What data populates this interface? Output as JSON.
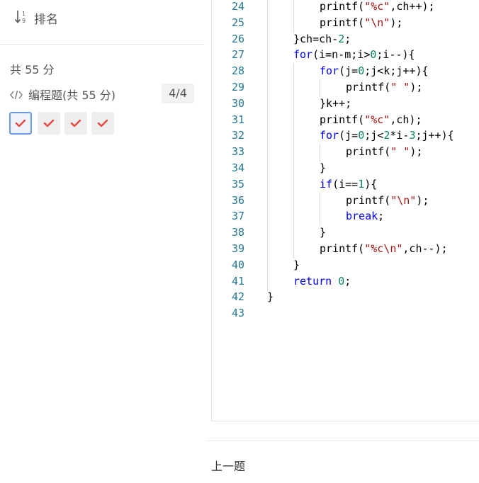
{
  "sidebar": {
    "rank_label": "排名",
    "total_score": "共 55 分",
    "section": {
      "label": "编程题(共 55 分)",
      "count": "4/4"
    },
    "answers": [
      {
        "status": "correct",
        "active": true
      },
      {
        "status": "correct",
        "active": false
      },
      {
        "status": "correct",
        "active": false
      },
      {
        "status": "correct",
        "active": false
      }
    ]
  },
  "code": {
    "lines": [
      {
        "num": "24",
        "indent": 2,
        "tokens": [
          [
            "",
            "printf("
          ],
          [
            "str",
            "\"%c\""
          ],
          [
            "",
            ",ch++);"
          ]
        ]
      },
      {
        "num": "25",
        "indent": 2,
        "tokens": [
          [
            "",
            "printf("
          ],
          [
            "str",
            "\"\\n\""
          ],
          [
            "",
            ");"
          ]
        ]
      },
      {
        "num": "26",
        "indent": 1,
        "tokens": [
          [
            "",
            "}ch=ch-"
          ],
          [
            "num",
            "2"
          ],
          [
            "",
            ";"
          ]
        ]
      },
      {
        "num": "27",
        "indent": 1,
        "tokens": [
          [
            "kw",
            "for"
          ],
          [
            "",
            "(i=n-m;i>"
          ],
          [
            "num",
            "0"
          ],
          [
            "",
            ";i--){"
          ]
        ]
      },
      {
        "num": "28",
        "indent": 2,
        "tokens": [
          [
            "kw",
            "for"
          ],
          [
            "",
            "(j="
          ],
          [
            "num",
            "0"
          ],
          [
            "",
            ";j<k;j++){"
          ]
        ]
      },
      {
        "num": "29",
        "indent": 3,
        "tokens": [
          [
            "",
            "printf("
          ],
          [
            "str",
            "\" \""
          ],
          [
            "",
            ");"
          ]
        ]
      },
      {
        "num": "30",
        "indent": 2,
        "tokens": [
          [
            "",
            "}k++;"
          ]
        ]
      },
      {
        "num": "31",
        "indent": 2,
        "tokens": [
          [
            "",
            "printf("
          ],
          [
            "str",
            "\"%c\""
          ],
          [
            "",
            ",ch);"
          ]
        ]
      },
      {
        "num": "32",
        "indent": 2,
        "tokens": [
          [
            "kw",
            "for"
          ],
          [
            "",
            "(j="
          ],
          [
            "num",
            "0"
          ],
          [
            "",
            ";j<"
          ],
          [
            "num",
            "2"
          ],
          [
            "",
            "*i-"
          ],
          [
            "num",
            "3"
          ],
          [
            "",
            ";j++){"
          ]
        ]
      },
      {
        "num": "33",
        "indent": 3,
        "tokens": [
          [
            "",
            "printf("
          ],
          [
            "str",
            "\" \""
          ],
          [
            "",
            ");"
          ]
        ]
      },
      {
        "num": "34",
        "indent": 2,
        "tokens": [
          [
            "",
            "}"
          ]
        ]
      },
      {
        "num": "35",
        "indent": 2,
        "tokens": [
          [
            "kw",
            "if"
          ],
          [
            "",
            "(i=="
          ],
          [
            "num",
            "1"
          ],
          [
            "",
            "){"
          ]
        ]
      },
      {
        "num": "36",
        "indent": 3,
        "tokens": [
          [
            "",
            "printf("
          ],
          [
            "str",
            "\"\\n\""
          ],
          [
            "",
            ");"
          ]
        ]
      },
      {
        "num": "37",
        "indent": 3,
        "tokens": [
          [
            "kw",
            "break"
          ],
          [
            "",
            ";"
          ]
        ]
      },
      {
        "num": "38",
        "indent": 2,
        "tokens": [
          [
            "",
            "}"
          ]
        ]
      },
      {
        "num": "39",
        "indent": 2,
        "tokens": [
          [
            "",
            "printf("
          ],
          [
            "str",
            "\"%c\\n\""
          ],
          [
            "",
            ",ch--);"
          ]
        ]
      },
      {
        "num": "40",
        "indent": 1,
        "tokens": [
          [
            "",
            "}"
          ]
        ]
      },
      {
        "num": "41",
        "indent": 1,
        "tokens": [
          [
            "kw",
            "return"
          ],
          [
            "",
            " "
          ],
          [
            "num",
            "0"
          ],
          [
            "",
            ";"
          ]
        ]
      },
      {
        "num": "42",
        "indent": 0,
        "tokens": [
          [
            "",
            "}"
          ]
        ]
      },
      {
        "num": "43",
        "indent": 0,
        "tokens": []
      }
    ]
  },
  "footer": {
    "prev_label": "上一题"
  },
  "colors": {
    "keyword": "#0000ff",
    "string": "#a31515",
    "number": "#098658",
    "line_number": "#237893",
    "check": "#e8453c",
    "active_border": "#6b9be0"
  }
}
